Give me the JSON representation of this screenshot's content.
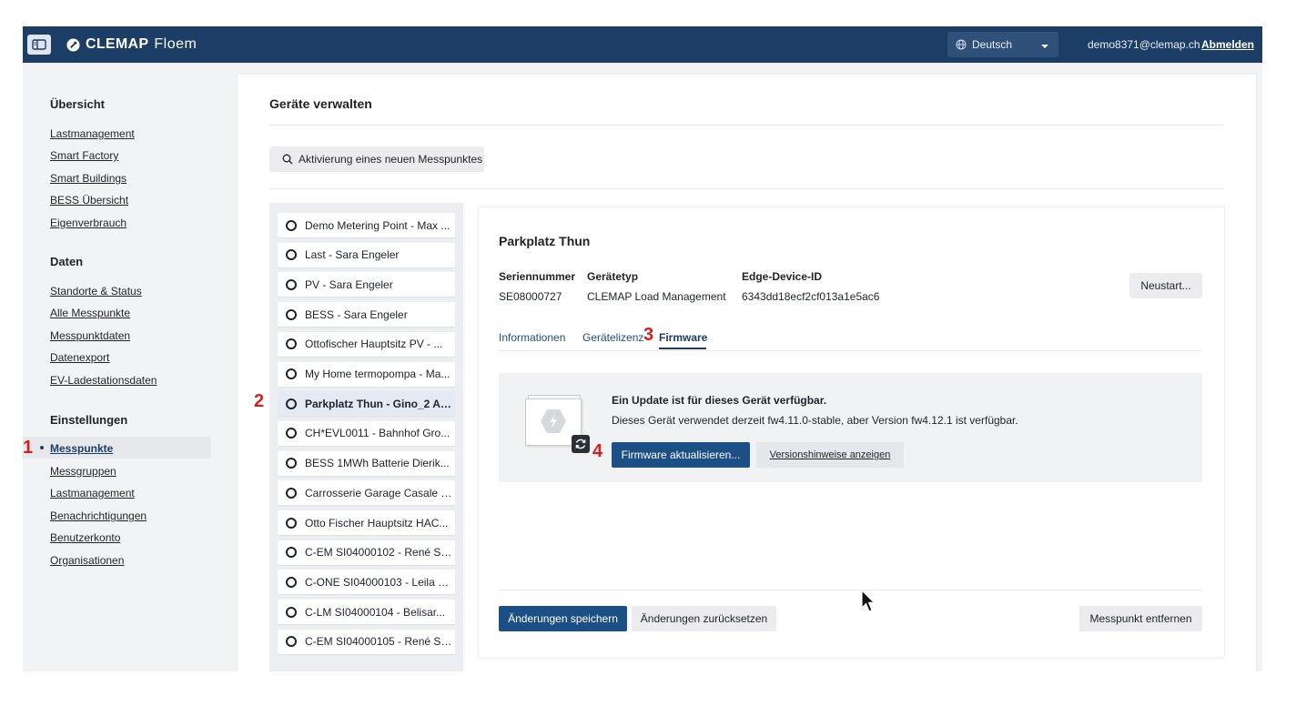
{
  "header": {
    "brand": "CLEMAP",
    "product": "Floem",
    "language": "Deutsch",
    "user_email": "demo8371@clemap.ch",
    "logout": "Abmelden",
    "brand_color": "#1c3e66"
  },
  "nav": {
    "sections": [
      {
        "heading": "Übersicht",
        "items": [
          "Lastmanagement",
          "Smart Factory",
          "Smart Buildings",
          "BESS Übersicht",
          "Eigenverbrauch"
        ]
      },
      {
        "heading": "Daten",
        "items": [
          "Standorte & Status",
          "Alle Messpunkte",
          "Messpunktdaten",
          "Datenexport",
          "EV-Ladestationsdaten"
        ]
      },
      {
        "heading": "Einstellungen",
        "items": [
          "Messpunkte",
          "Messgruppen",
          "Lastmanagement",
          "Benachrichtigungen",
          "Benutzerkonto",
          "Organisationen"
        ]
      }
    ],
    "active_item": "Messpunkte"
  },
  "main": {
    "title": "Geräte verwalten",
    "activate_button": "Aktivierung eines neuen Messpunktes"
  },
  "devices": [
    "Demo Metering Point - Max ...",
    "Last - Sara Engeler",
    "PV - Sara Engeler",
    "BESS - Sara Engeler",
    "Ottofischer Hauptsitz PV - ...",
    "My Home termopompa - Ma...",
    "Parkplatz Thun - Gino_2 Ag...",
    "CH*EVL0011 - Bahnhof Gro...",
    "BESS 1MWh Batterie Dierik...",
    "Carrosserie Garage Casale - ...",
    "Otto Fischer Hauptsitz HAC...",
    "C-EM SI04000102 - René Sc...",
    "C-ONE SI04000103 - Leila L...",
    "C-LM SI04000104 - Belisar...",
    "C-EM SI04000105 - René Sc..."
  ],
  "selected_device_index": 6,
  "detail": {
    "name": "Parkplatz Thun",
    "serial_label": "Seriennummer",
    "serial_value": "SE08000727",
    "type_label": "Gerätetyp",
    "type_value": "CLEMAP Load Management",
    "edge_label": "Edge-Device-ID",
    "edge_value": "6343dd18ecf2cf013a1e5ac6",
    "restart_button": "Neustart...",
    "tabs": [
      "Informationen",
      "Gerätelizenz",
      "Firmware"
    ],
    "active_tab": "Firmware",
    "firmware": {
      "title": "Ein Update ist für dieses Gerät verfügbar.",
      "description": "Dieses Gerät verwendet derzeit fw4.11.0-stable, aber Version fw4.12.1 ist verfügbar.",
      "update_button": "Firmware aktualisieren...",
      "notes_button": "Versionshinweise anzeigen"
    },
    "save_button": "Änderungen speichern",
    "reset_button": "Änderungen zurücksetzen",
    "remove_button": "Messpunkt entfernen"
  },
  "steps": [
    "1",
    "2",
    "3",
    "4"
  ],
  "step_color": "#d51f1f"
}
